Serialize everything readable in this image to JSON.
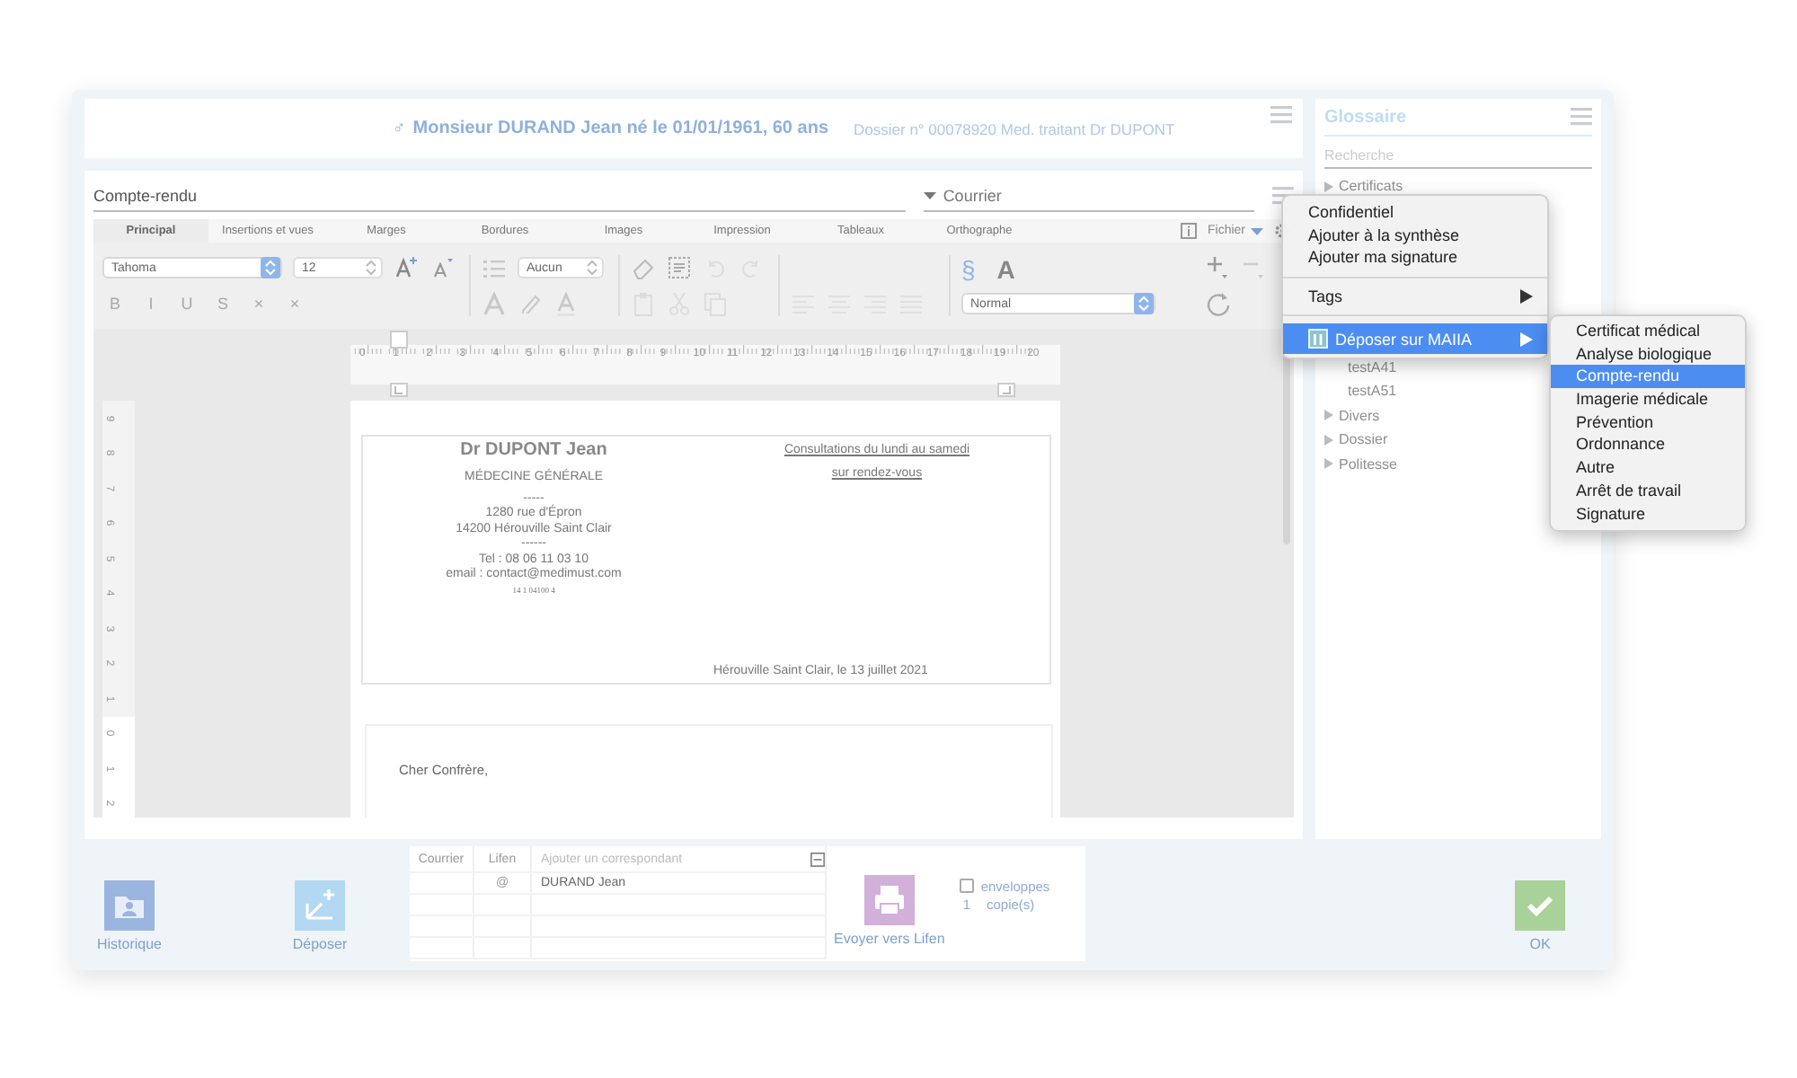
{
  "header": {
    "sex_symbol": "♂",
    "patient": "Monsieur DURAND Jean né le 01/01/1961, 60 ans",
    "dossier": "Dossier n° 00078920 Med. traitant Dr DUPONT"
  },
  "editor": {
    "title_field": "Compte-rendu",
    "type_dropdown": "Courrier",
    "tabs": [
      {
        "label": "Principal",
        "selected": true
      },
      {
        "label": "Insertions et vues",
        "selected": false
      },
      {
        "label": "Marges",
        "selected": false
      },
      {
        "label": "Bordures",
        "selected": false
      },
      {
        "label": "Images",
        "selected": false
      },
      {
        "label": "Impression",
        "selected": false
      },
      {
        "label": "Tableaux",
        "selected": false
      },
      {
        "label": "Orthographe",
        "selected": false
      }
    ],
    "file_menu": "Fichier",
    "toolbar": {
      "font": "Tahoma",
      "size": "12",
      "list_style": "Aucun",
      "paragraph_style": "Normal",
      "section_symbol": "§",
      "style_letter": "A",
      "format_buttons": [
        {
          "label": "B",
          "disabled": true
        },
        {
          "label": "I",
          "disabled": true
        },
        {
          "label": "U",
          "disabled": true
        },
        {
          "label": "S",
          "disabled": true
        },
        {
          "label": "×",
          "disabled": true
        },
        {
          "label": "×",
          "disabled": true
        }
      ]
    },
    "ruler": {
      "labels": [
        "0",
        "1",
        "2",
        "3",
        "4",
        "5",
        "6",
        "7",
        "8",
        "9",
        "10",
        "11",
        "12",
        "13",
        "14",
        "15",
        "16",
        "17",
        "18",
        "19",
        "20"
      ],
      "vertical_labels": [
        "9",
        "8",
        "7",
        "6",
        "5",
        "4",
        "3",
        "2",
        "1",
        "0",
        "1",
        "2"
      ]
    },
    "letterhead": {
      "left": [
        {
          "kind": "name",
          "text": "Dr DUPONT Jean"
        },
        {
          "kind": "title",
          "text": "MÉDECINE GÉNÉRALE"
        },
        {
          "kind": "line",
          "text": "-----"
        },
        {
          "kind": "line",
          "text": "1280 rue d'Épron"
        },
        {
          "kind": "line",
          "text": "14200 Hérouville Saint Clair"
        },
        {
          "kind": "line",
          "text": "------"
        },
        {
          "kind": "line",
          "text": "Tel : 08 06 11 03 10"
        },
        {
          "kind": "line",
          "text": "email : contact@medimust.com"
        },
        {
          "kind": "small",
          "text": "14 1 04100 4"
        }
      ],
      "right": [
        "Consultations du lundi au samedi",
        "sur rendez-vous"
      ],
      "date": "Hérouville Saint Clair, le 13 juillet 2021"
    },
    "greeting": "Cher Confrère,"
  },
  "glossary": {
    "title": "Glossaire",
    "search_placeholder": "Recherche",
    "items": [
      {
        "label": "Certificats",
        "children": [
          {
            "label": "testA41"
          },
          {
            "label": "testA51"
          }
        ]
      },
      {
        "label": "Divers"
      },
      {
        "label": "Dossier"
      },
      {
        "label": "Politesse"
      }
    ]
  },
  "context_menu": [
    {
      "kind": "item",
      "label": "Confidentiel",
      "selected": false
    },
    {
      "kind": "item",
      "label": "Ajouter à la synthèse",
      "selected": false
    },
    {
      "kind": "item",
      "label": "Ajouter ma signature",
      "selected": false
    },
    {
      "kind": "separator"
    },
    {
      "kind": "submenu",
      "label": "Tags",
      "selected": false
    },
    {
      "kind": "separator"
    },
    {
      "kind": "submenu",
      "label": "Déposer sur MAIIA",
      "icon": true,
      "selected": true
    }
  ],
  "submenu": [
    {
      "label": "Certificat médical",
      "selected": false
    },
    {
      "label": "Analyse biologique",
      "selected": false
    },
    {
      "label": "Compte-rendu",
      "selected": true
    },
    {
      "label": "Imagerie médicale",
      "selected": false
    },
    {
      "label": "Prévention",
      "selected": false
    },
    {
      "label": "Ordonnance",
      "selected": false
    },
    {
      "label": "Autre",
      "selected": false
    },
    {
      "label": "Arrêt de travail",
      "selected": false
    },
    {
      "label": "Signature",
      "selected": false
    }
  ],
  "bottom": {
    "history_button": "Historique",
    "deposit_button": "Déposer",
    "recipients": {
      "columns": [
        "Courrier",
        "Lifen"
      ],
      "add_placeholder": "Ajouter un correspondant",
      "rows": [
        {
          "lifen": "@",
          "name": "DURAND Jean"
        }
      ]
    },
    "send_button": "Evoyer vers Lifen",
    "envelopes": {
      "label": "enveloppes",
      "checked": false
    },
    "copies": {
      "count": "1",
      "label": "copie(s)"
    },
    "ok_button": "OK"
  }
}
